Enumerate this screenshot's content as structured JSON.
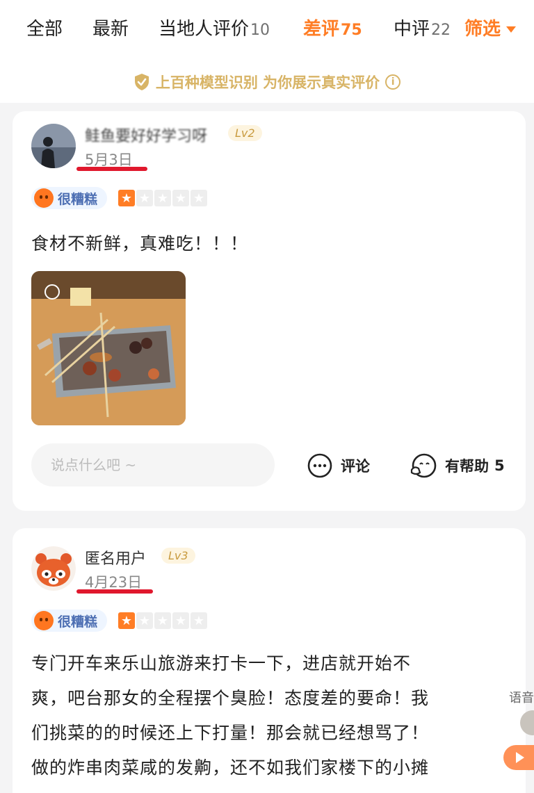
{
  "tabs": [
    {
      "label": "全部",
      "count": ""
    },
    {
      "label": "最新",
      "count": ""
    },
    {
      "label": "当地人评价",
      "count": "10"
    },
    {
      "label": "差评",
      "count": "75"
    },
    {
      "label": "中评",
      "count": "22"
    }
  ],
  "filter_label": "筛选",
  "banner": {
    "text": "上百种模型识别 为你展示真实评价",
    "info_glyph": "i"
  },
  "reviews": [
    {
      "username": "鲑鱼要好好学习呀",
      "level": "Lv2",
      "date": "5月3日",
      "rating_label": "很糟糕",
      "stars": 1,
      "max_stars": 5,
      "text_lines": [
        "食材不新鲜，真难吃！！！"
      ],
      "comment_placeholder": "说点什么吧 ~",
      "comment_label": "评论",
      "helpful_label": "有帮助",
      "helpful_count": "5"
    },
    {
      "username": "匿名用户",
      "level": "Lv3",
      "date": "4月23日",
      "rating_label": "很糟糕",
      "stars": 1,
      "max_stars": 5,
      "text_lines": [
        "专门开车来乐山旅游来打卡一下，进店就开始不",
        "爽，吧台那女的全程摆个臭脸！态度差的要命！我",
        "们挑菜的的时候还上下打量！那会就已经想骂了！",
        "做的炸串肉菜咸的发齁，还不如我们家楼下的小摊"
      ]
    }
  ],
  "side_voice_label": "语音",
  "colors": {
    "accent": "#ff7d25",
    "badge_text": "#4d6fb3",
    "underline": "#e0182d",
    "banner": "#d8b466"
  }
}
